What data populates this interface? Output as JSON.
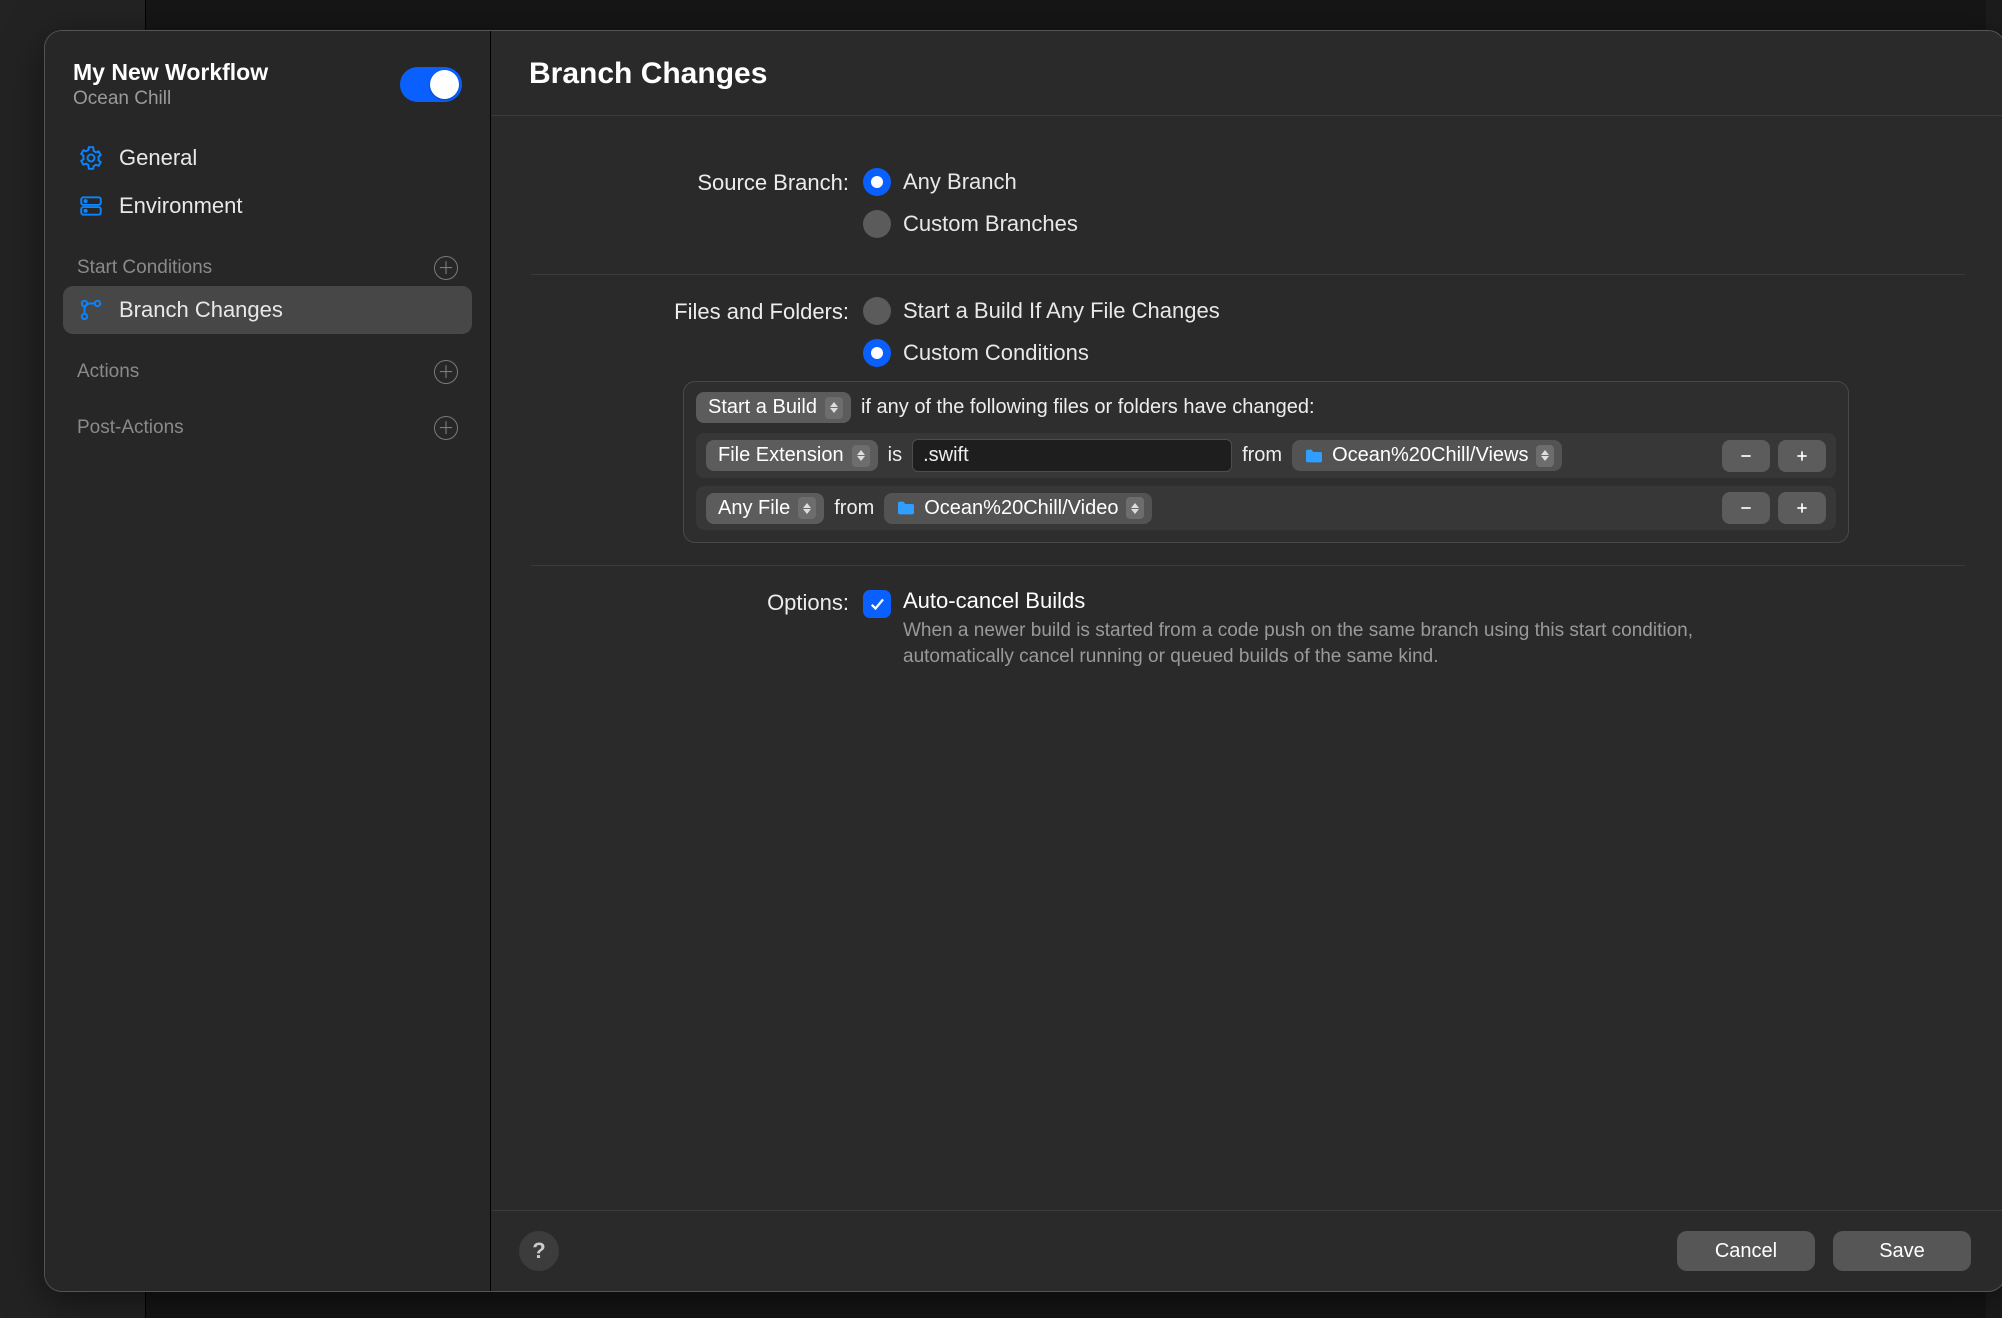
{
  "workflow": {
    "name": "My New Workflow",
    "project": "Ocean Chill",
    "enabled": true
  },
  "sidebar": {
    "nav": [
      {
        "label": "General"
      },
      {
        "label": "Environment"
      }
    ],
    "sections": {
      "start_conditions": {
        "title": "Start Conditions",
        "items": [
          {
            "label": "Branch Changes"
          }
        ]
      },
      "actions": {
        "title": "Actions"
      },
      "post_actions": {
        "title": "Post-Actions"
      }
    }
  },
  "page": {
    "title": "Branch Changes"
  },
  "source_branch": {
    "label": "Source Branch:",
    "any_label": "Any Branch",
    "custom_label": "Custom Branches",
    "selected": "any"
  },
  "files": {
    "label": "Files and Folders:",
    "any_label": "Start a Build If Any File Changes",
    "custom_label": "Custom Conditions",
    "selected": "custom",
    "action_select": "Start a Build",
    "action_suffix": "if any of the following files or folders have changed:",
    "rows": [
      {
        "type_select": "File Extension",
        "is_label": "is",
        "value": ".swift",
        "from_label": "from",
        "location": "Ocean%20Chill/Views"
      },
      {
        "type_select": "Any File",
        "from_label": "from",
        "location": "Ocean%20Chill/Video"
      }
    ]
  },
  "options": {
    "label": "Options:",
    "auto_cancel": {
      "title": "Auto-cancel Builds",
      "description": "When a newer build is started from a code push on the same branch using this start condition, automatically cancel running or queued builds of the same kind.",
      "checked": true
    }
  },
  "buttons": {
    "cancel": "Cancel",
    "save": "Save"
  }
}
